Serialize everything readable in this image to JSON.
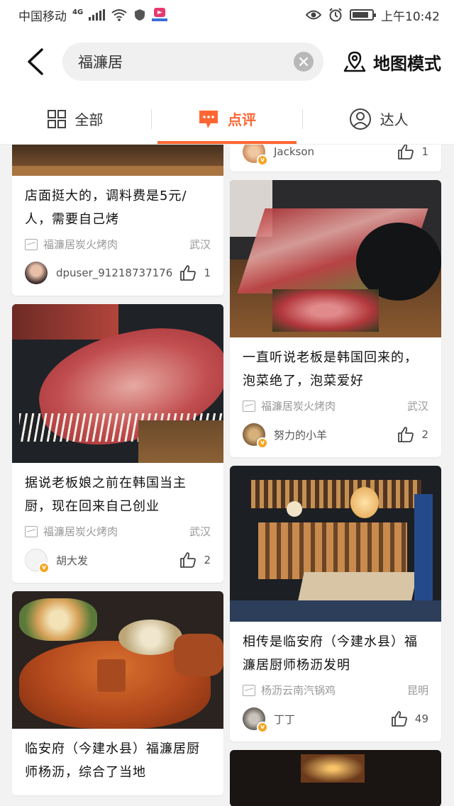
{
  "status": {
    "carrier": "中国移动",
    "net": "4G",
    "time": "上午10:42",
    "battery_level": 0.85
  },
  "header": {
    "search_value": "福濂居",
    "map_mode_label": "地图模式"
  },
  "tabs": [
    {
      "label": "全部",
      "icon": "grid-icon"
    },
    {
      "label": "点评",
      "icon": "comment-icon"
    },
    {
      "label": "达人",
      "icon": "person-icon"
    }
  ],
  "feed": {
    "left": [
      {
        "title": "店面挺大的，调料费是5元/人，需要自己烤",
        "shop": "福濂居炭火烤肉",
        "city": "武汉",
        "user": "dpuser_91218737176",
        "likes": "1"
      },
      {
        "title": "据说老板娘之前在韩国当主厨，现在回来自己创业",
        "shop": "福濂居炭火烤肉",
        "city": "武汉",
        "user": "胡大发",
        "likes": "2"
      },
      {
        "title": "临安府（今建水县）福濂居厨师杨沥，综合了当地"
      }
    ],
    "right": [
      {
        "user": "Jackson",
        "likes": "1"
      },
      {
        "title": "一直听说老板是韩国回来的，泡菜绝了，泡菜爱好",
        "shop": "福濂居炭火烤肉",
        "city": "武汉",
        "user": "努力的小羊",
        "likes": "2"
      },
      {
        "title": "相传是临安府（今建水县）福濂居厨师杨沥发明",
        "shop": "杨沥云南汽锅鸡",
        "city": "昆明",
        "user": "丁丁",
        "likes": "49"
      }
    ]
  }
}
